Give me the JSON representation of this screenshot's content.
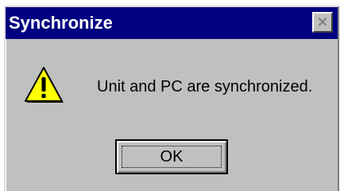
{
  "dialog": {
    "title": "Synchronize",
    "close_glyph": "×",
    "icon": "warning-icon",
    "message": "Unit and PC are synchronized.",
    "ok_label": "OK"
  },
  "colors": {
    "titlebar": "#000080",
    "dialog_face": "#c0c0c0",
    "warning_fill": "#ffff00"
  }
}
